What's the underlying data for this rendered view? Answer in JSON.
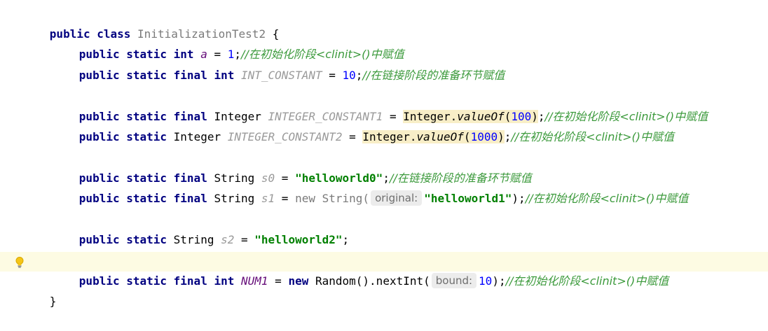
{
  "class_header": {
    "kw_public": "public",
    "kw_class": "class",
    "class_name": "InitializationTest2",
    "brace": "{"
  },
  "lines": {
    "a": {
      "mods": "public static int",
      "name": "a",
      "eq": " = ",
      "value": "1",
      "semi": ";",
      "comment": "//在初始化阶段<clinit>()中赋值"
    },
    "int_constant": {
      "mods": "public static final int",
      "name": "INT_CONSTANT",
      "eq": " = ",
      "value": "10",
      "semi": ";",
      "comment": "//在链接阶段的准备环节赋值"
    },
    "integer_constant1": {
      "mods": "public static final",
      "type": "Integer",
      "name": "INTEGER_CONSTANT1",
      "eq": " = ",
      "call_obj": "Integer.",
      "call_meth": "valueOf",
      "paren_open": "(",
      "value": "100",
      "paren_close": ")",
      "semi": ";",
      "comment": "//在初始化阶段<clinit>()中赋值"
    },
    "integer_constant2": {
      "mods": "public static",
      "type": "Integer",
      "name": "INTEGER_CONSTANT2",
      "eq": " = ",
      "call_obj": "Integer.",
      "call_meth": "valueOf",
      "paren_open": "(",
      "value": "1000",
      "paren_close": ")",
      "semi": ";",
      "comment": "//在初始化阶段<clinit>()中赋值"
    },
    "s0": {
      "mods": "public static final",
      "type": "String",
      "name": "s0",
      "eq": " = ",
      "value": "\"helloworld0\"",
      "semi": ";",
      "comment": "//在链接阶段的准备环节赋值"
    },
    "s1": {
      "mods": "public static final",
      "type": "String",
      "name": "s1",
      "eq": " = ",
      "kw_new": "new",
      "ctor": "String(",
      "hint": "original:",
      "value": "\"helloworld1\"",
      "close": ");",
      "comment": "//在初始化阶段<clinit>()中赋值"
    },
    "s2": {
      "mods": "public static",
      "type": "String",
      "name": "s2",
      "eq": " = ",
      "value": "\"helloworld2\"",
      "semi": ";"
    },
    "num1": {
      "mods": "public static final int",
      "name": "NUM1",
      "eq": " = ",
      "kw_new": "new",
      "call": "Random().nextInt(",
      "hint": "bound:",
      "value": "10",
      "close": ");",
      "comment": "//在初始化阶段<clinit>()中赋值"
    }
  },
  "class_close": "}",
  "colors": {
    "keyword": "#000080",
    "static_field": "#660e7a",
    "number": "#0000ff",
    "string": "#008000",
    "comment": "#3c9a3c",
    "current_line": "#fdfbe3",
    "boxed_highlight": "#f8eec7"
  },
  "gutter": {
    "icon": "lightbulb-icon"
  }
}
